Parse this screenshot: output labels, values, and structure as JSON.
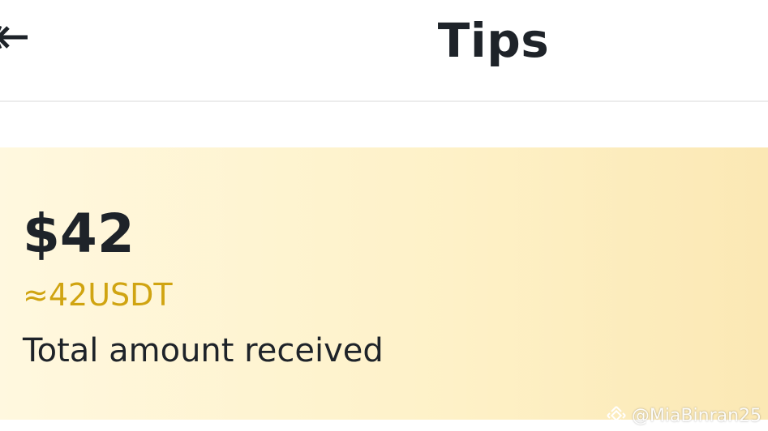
{
  "header": {
    "title": "Tips",
    "back_icon": "arrow-left-icon"
  },
  "summary": {
    "amount": "$42",
    "approx_usdt": "≈42USDT",
    "caption": "Total amount received"
  },
  "watermark": {
    "text": "@MiaBinran25",
    "logo_icon": "binance-logo-icon"
  },
  "colors": {
    "accent": "#D0A411",
    "text_primary": "#1E2329",
    "card_bg_start": "#FFF8DF",
    "card_bg_end": "#FBE8B4"
  }
}
